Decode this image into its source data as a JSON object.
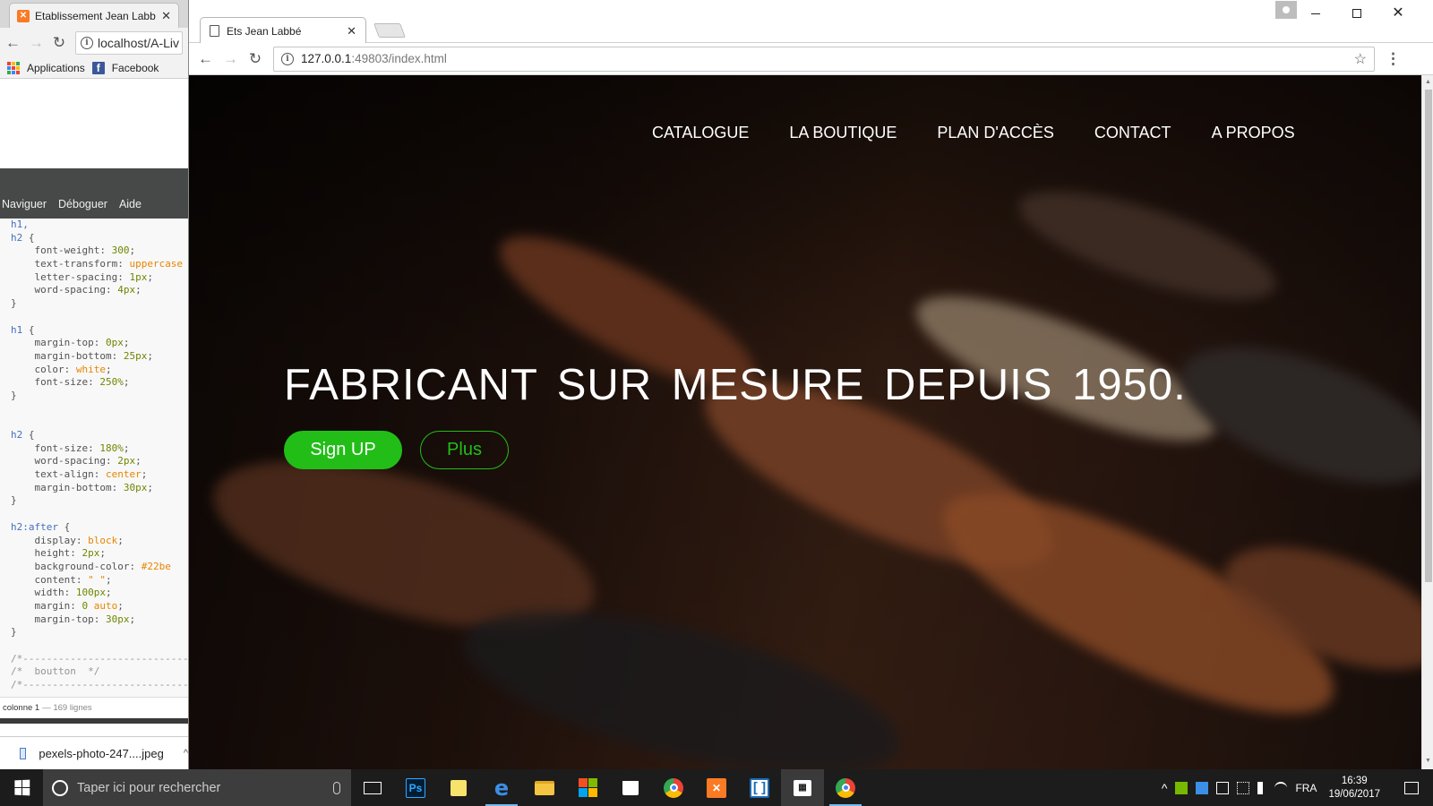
{
  "bg_browser": {
    "tab_title": "Etablissement Jean Labbé",
    "url": "localhost/A-Liv",
    "bookmarks": [
      "Applications",
      "Facebook"
    ]
  },
  "editor": {
    "menu": [
      "Naviguer",
      "Déboguer",
      "Aide"
    ],
    "code_lines": [
      [
        [
          "c-sel",
          "h1,"
        ]
      ],
      [
        [
          "c-sel",
          "h2"
        ],
        [
          "c-br",
          " {"
        ]
      ],
      [
        [
          "c-prop",
          "    font-weight: "
        ],
        [
          "c-num",
          "300"
        ],
        [
          "c-prop",
          ";"
        ]
      ],
      [
        [
          "c-prop",
          "    text-transform: "
        ],
        [
          "c-val",
          "uppercase"
        ]
      ],
      [
        [
          "c-prop",
          "    letter-spacing: "
        ],
        [
          "c-num",
          "1px"
        ],
        [
          "c-prop",
          ";"
        ]
      ],
      [
        [
          "c-prop",
          "    word-spacing: "
        ],
        [
          "c-num",
          "4px"
        ],
        [
          "c-prop",
          ";"
        ]
      ],
      [
        [
          "c-br",
          "}"
        ]
      ],
      [],
      [
        [
          "c-sel",
          "h1"
        ],
        [
          "c-br",
          " {"
        ]
      ],
      [
        [
          "c-prop",
          "    margin-top: "
        ],
        [
          "c-num",
          "0px"
        ],
        [
          "c-prop",
          ";"
        ]
      ],
      [
        [
          "c-prop",
          "    margin-bottom: "
        ],
        [
          "c-num",
          "25px"
        ],
        [
          "c-prop",
          ";"
        ]
      ],
      [
        [
          "c-prop",
          "    color: "
        ],
        [
          "c-val",
          "white"
        ],
        [
          "c-prop",
          ";"
        ]
      ],
      [
        [
          "c-prop",
          "    font-size: "
        ],
        [
          "c-num",
          "250%"
        ],
        [
          "c-prop",
          ";"
        ]
      ],
      [
        [
          "c-br",
          "}"
        ]
      ],
      [],
      [],
      [
        [
          "c-sel",
          "h2"
        ],
        [
          "c-br",
          " {"
        ]
      ],
      [
        [
          "c-prop",
          "    font-size: "
        ],
        [
          "c-num",
          "180%"
        ],
        [
          "c-prop",
          ";"
        ]
      ],
      [
        [
          "c-prop",
          "    word-spacing: "
        ],
        [
          "c-num",
          "2px"
        ],
        [
          "c-prop",
          ";"
        ]
      ],
      [
        [
          "c-prop",
          "    text-align: "
        ],
        [
          "c-val",
          "center"
        ],
        [
          "c-prop",
          ";"
        ]
      ],
      [
        [
          "c-prop",
          "    margin-bottom: "
        ],
        [
          "c-num",
          "30px"
        ],
        [
          "c-prop",
          ";"
        ]
      ],
      [
        [
          "c-br",
          "}"
        ]
      ],
      [],
      [
        [
          "c-sel",
          "h2:after"
        ],
        [
          "c-br",
          " {"
        ]
      ],
      [
        [
          "c-prop",
          "    display: "
        ],
        [
          "c-val",
          "block"
        ],
        [
          "c-prop",
          ";"
        ]
      ],
      [
        [
          "c-prop",
          "    height: "
        ],
        [
          "c-num",
          "2px"
        ],
        [
          "c-prop",
          ";"
        ]
      ],
      [
        [
          "c-prop",
          "    background-color: "
        ],
        [
          "c-val",
          "#22be"
        ]
      ],
      [
        [
          "c-prop",
          "    content: "
        ],
        [
          "c-val",
          "\" \""
        ],
        [
          "c-prop",
          ";"
        ]
      ],
      [
        [
          "c-prop",
          "    width: "
        ],
        [
          "c-num",
          "100px"
        ],
        [
          "c-prop",
          ";"
        ]
      ],
      [
        [
          "c-prop",
          "    margin: "
        ],
        [
          "c-num",
          "0 "
        ],
        [
          "c-val",
          "auto"
        ],
        [
          "c-prop",
          ";"
        ]
      ],
      [
        [
          "c-prop",
          "    margin-top: "
        ],
        [
          "c-num",
          "30px"
        ],
        [
          "c-prop",
          ";"
        ]
      ],
      [
        [
          "c-br",
          "}"
        ]
      ],
      [],
      [
        [
          "c-cmt",
          "/*----------------------------"
        ]
      ],
      [
        [
          "c-cmt",
          "/*  boutton  */"
        ]
      ],
      [
        [
          "c-cmt",
          "/*----------------------------"
        ]
      ]
    ],
    "status_col": "colonne 1",
    "status_lines": "— 169 lignes"
  },
  "download": {
    "filename": "pexels-photo-247....jpeg",
    "caret": "^"
  },
  "main_browser": {
    "tab_title": "Ets Jean Labbé",
    "url_host": "127.0.0.1",
    "url_path": ":49803/index.html"
  },
  "site": {
    "nav": [
      "CATALOGUE",
      "LA BOUTIQUE",
      "PLAN D'ACCÈS",
      "CONTACT",
      "A PROPOS"
    ],
    "hero_title": "FABRICANT SUR MESURE DEPUIS 1950.",
    "btn_primary": "Sign UP",
    "btn_secondary": "Plus",
    "accent": "#22be17"
  },
  "taskbar": {
    "search_placeholder": "Taper ici pour rechercher",
    "lang": "FRA",
    "time": "16:39",
    "date": "19/06/2017"
  },
  "icons": {
    "close": "✕",
    "back": "←",
    "forward": "→",
    "reload": "↻",
    "star": "☆",
    "kebab": "⋮",
    "info": "i",
    "xampp": "✕",
    "photoshop": "Ps",
    "edge": "e",
    "tray_up": "^"
  }
}
